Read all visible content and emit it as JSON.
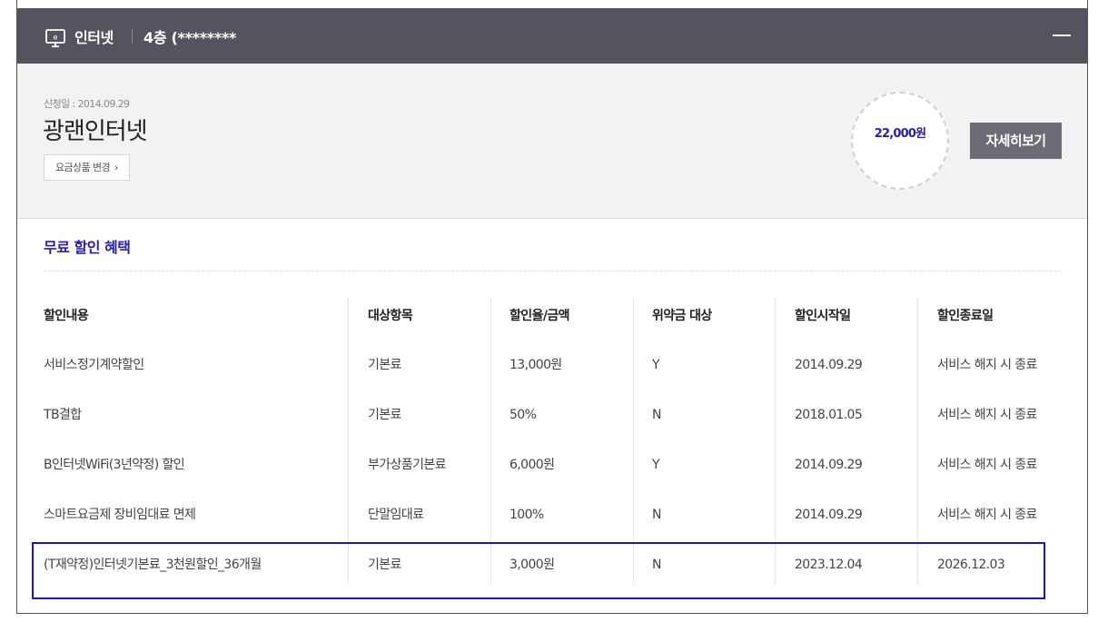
{
  "header": {
    "title": "인터넷",
    "location": "4층 (********",
    "icon": "monitor-e-icon",
    "collapse_icon": "minus-icon"
  },
  "summary": {
    "apply_date": "신청일 : 2014.09.29",
    "product_name": "광랜인터넷",
    "change_button": "요금상품 변경",
    "price": "22,000원",
    "detail_button": "자세히보기"
  },
  "benefits": {
    "title": "무료 할인 혜택",
    "columns": [
      "할인내용",
      "대상항목",
      "할인율/금액",
      "위약금 대상",
      "할인시작일",
      "할인종료일"
    ],
    "rows": [
      [
        "서비스정기계약할인",
        "기본료",
        "13,000원",
        "Y",
        "2014.09.29",
        "서비스 해지 시 종료"
      ],
      [
        "TB결합",
        "기본료",
        "50%",
        "N",
        "2018.01.05",
        "서비스 해지 시 종료"
      ],
      [
        "B인터넷WiFi(3년약정) 할인",
        "부가상품기본료",
        "6,000원",
        "Y",
        "2014.09.29",
        "서비스 해지 시 종료"
      ],
      [
        "스마트요금제 장비임대료 면제",
        "단말임대료",
        "100%",
        "N",
        "2014.09.29",
        "서비스 해지 시 종료"
      ],
      [
        "(T재약정)인터넷기본료_3천원할인_36개월",
        "기본료",
        "3,000원",
        "N",
        "2023.12.04",
        "2026.12.03"
      ]
    ]
  },
  "colors": {
    "header_bg": "#56535f",
    "accent": "#2b21a8",
    "highlight": "#1a14d0"
  }
}
